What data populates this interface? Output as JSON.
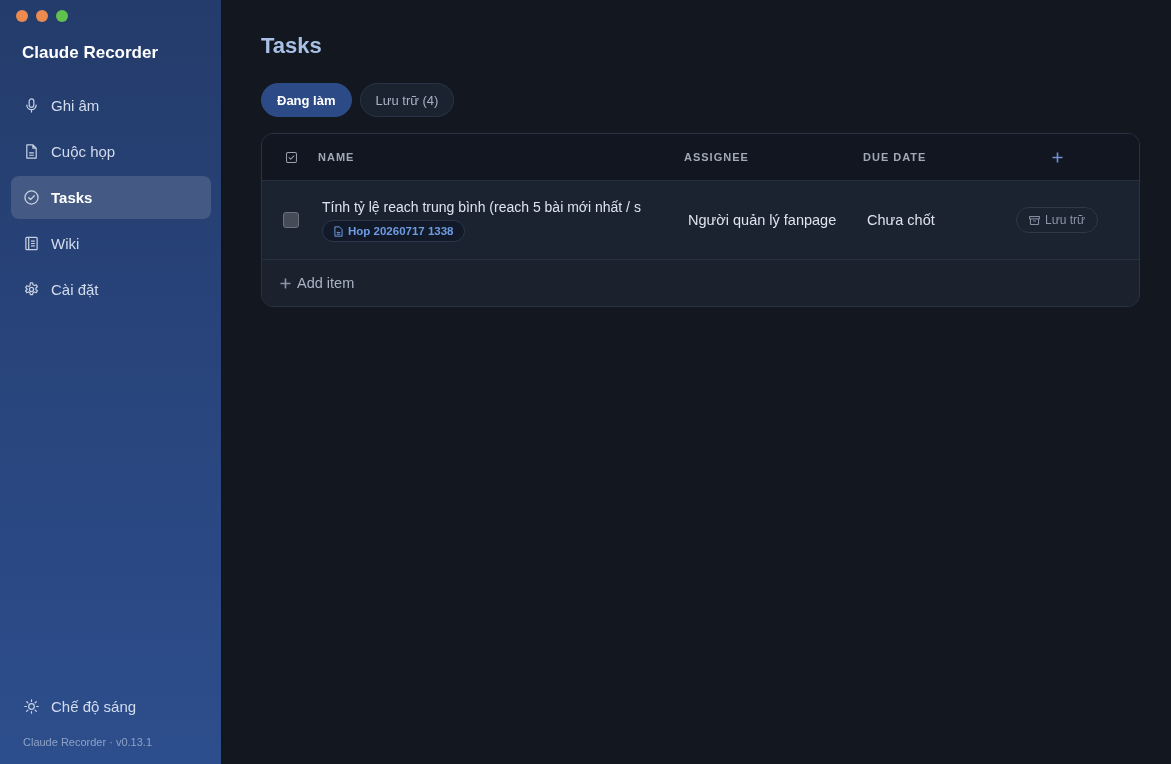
{
  "sidebar": {
    "app_title": "Claude Recorder",
    "items": [
      {
        "label": "Ghi âm",
        "selected": false
      },
      {
        "label": "Cuộc họp",
        "selected": false
      },
      {
        "label": "Tasks",
        "selected": true
      },
      {
        "label": "Wiki",
        "selected": false
      },
      {
        "label": "Cài đặt",
        "selected": false
      }
    ],
    "theme_toggle": "Chế độ sáng",
    "version": "Claude Recorder · v0.13.1"
  },
  "page": {
    "title": "Tasks"
  },
  "tabs": [
    {
      "label": "Đang làm",
      "selected": true
    },
    {
      "label": "Lưu trữ (4)",
      "selected": false
    }
  ],
  "table": {
    "columns": [
      "NAME",
      "ASSIGNEE",
      "DUE DATE"
    ],
    "rows": [
      {
        "checked": false,
        "name": "Tính tỷ lệ reach trung bình (reach 5 bài mới nhất / s",
        "source": "Hop 20260717 1338",
        "assignee": "Người quản lý fanpage",
        "due_date": "Chưa chốt",
        "action": "Lưu trữ"
      }
    ],
    "add_item": "Add item"
  }
}
